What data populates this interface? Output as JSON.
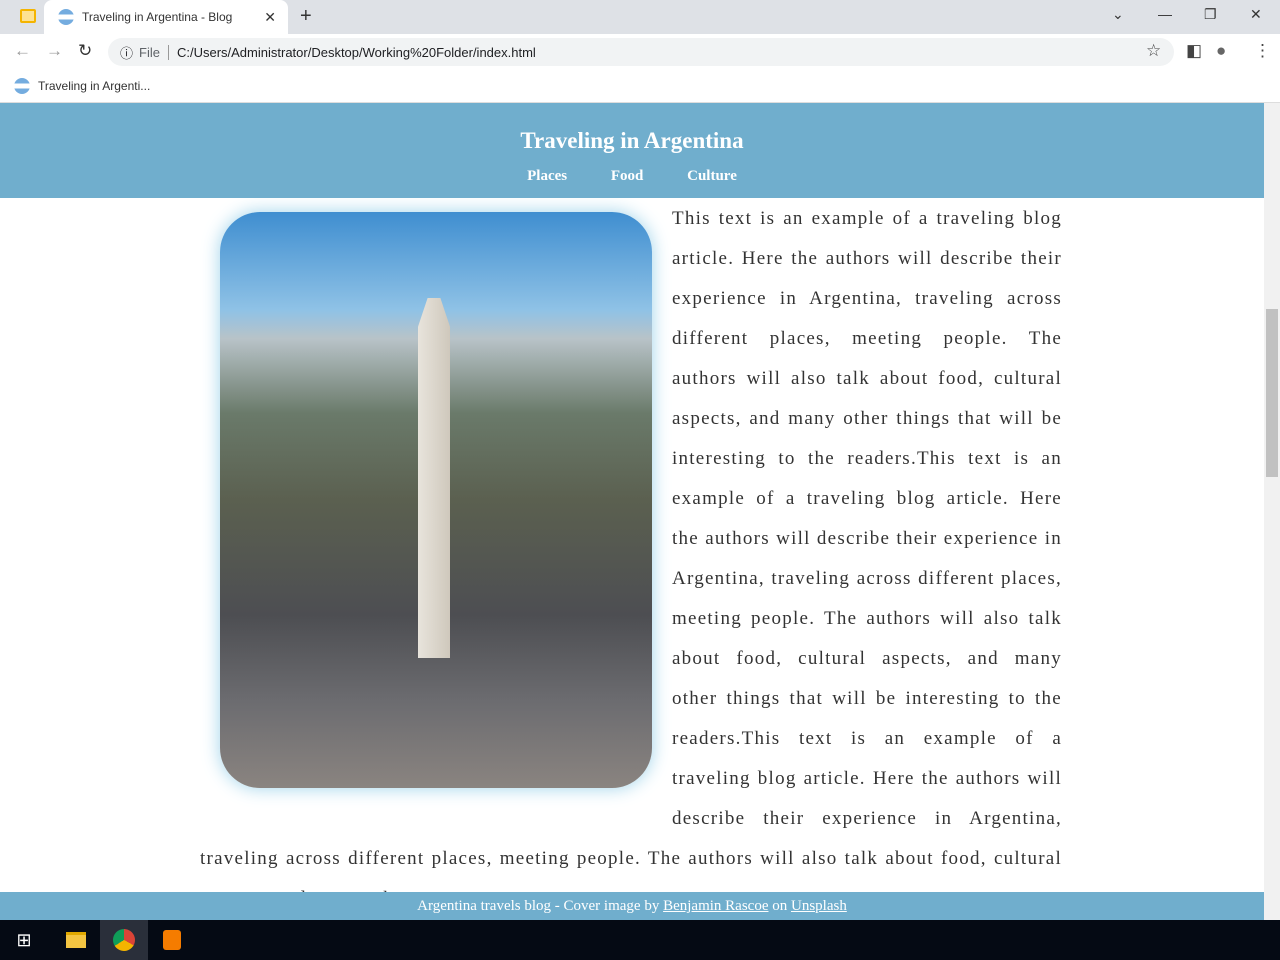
{
  "browser": {
    "tab_title": "Traveling in Argentina - Blog",
    "url_scheme": "File",
    "url": "C:/Users/Administrator/Desktop/Working%20Folder/index.html",
    "bookmark": "Traveling in Argenti..."
  },
  "header": {
    "title": "Traveling in Argentina",
    "nav": [
      "Places",
      "Food",
      "Culture"
    ]
  },
  "article": {
    "text": "This text is an example of a traveling blog article. Here the authors will describe their experience in Argentina, traveling across different places, meeting people. The authors will also talk about food, cultural aspects, and many other things that will be interesting to the readers.This text is an example of a traveling blog article. Here the authors will describe their experience in Argentina, traveling across different places, meeting people. The authors will also talk about food, cultural aspects, and many other things that will be interesting to the readers.This text is an example of a traveling blog article. Here the authors will describe their experience in Argentina, traveling across different places, meeting people. The authors will also talk about food, cultural aspects, and many other"
  },
  "footer": {
    "prefix": "Argentina travels blog - Cover image by",
    "author": "Benjamin Rascoe",
    "on": "on",
    "site": "Unsplash"
  }
}
